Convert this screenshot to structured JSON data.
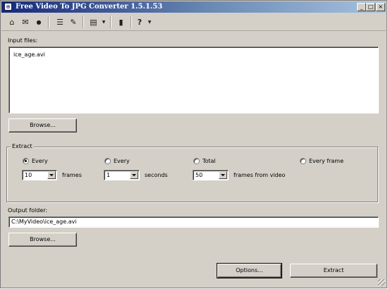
{
  "window": {
    "title": "Free Video To JPG Converter 1.5.1.53",
    "controls": {
      "minimize": "_",
      "maximize": "□",
      "close": "×"
    }
  },
  "toolbar": {
    "items": [
      {
        "icon": "home-icon",
        "glyph": "⌂"
      },
      {
        "icon": "mail-icon",
        "glyph": "✉"
      },
      {
        "icon": "user-icon",
        "glyph": "●"
      },
      {
        "icon": "list-icon",
        "glyph": "☰"
      },
      {
        "icon": "edit-icon",
        "glyph": "✎"
      },
      {
        "icon": "window-icon",
        "glyph": "▤"
      },
      {
        "icon": "film-icon",
        "glyph": "▮"
      },
      {
        "icon": "help-icon",
        "glyph": "?"
      }
    ],
    "dropdown_caret": "▼"
  },
  "input": {
    "label": "Input files:",
    "files": [
      "ice_age.avi"
    ],
    "browse_label": "Browse..."
  },
  "extract": {
    "group_label": "Extract",
    "mode1": {
      "label": "Every",
      "selected": true,
      "value": "10",
      "unit": "frames"
    },
    "mode2": {
      "label": "Every",
      "selected": false,
      "value": "1",
      "unit": "seconds"
    },
    "mode3": {
      "label": "Total",
      "selected": false,
      "value": "50",
      "unit": "frames from video"
    },
    "mode4": {
      "label": "Every frame",
      "selected": false
    }
  },
  "output": {
    "label": "Output folder:",
    "value": "C:\\MyVideo\\ice_age.avi",
    "browse_label": "Browse..."
  },
  "footer": {
    "options_label": "Options...",
    "extract_label": "Extract"
  }
}
